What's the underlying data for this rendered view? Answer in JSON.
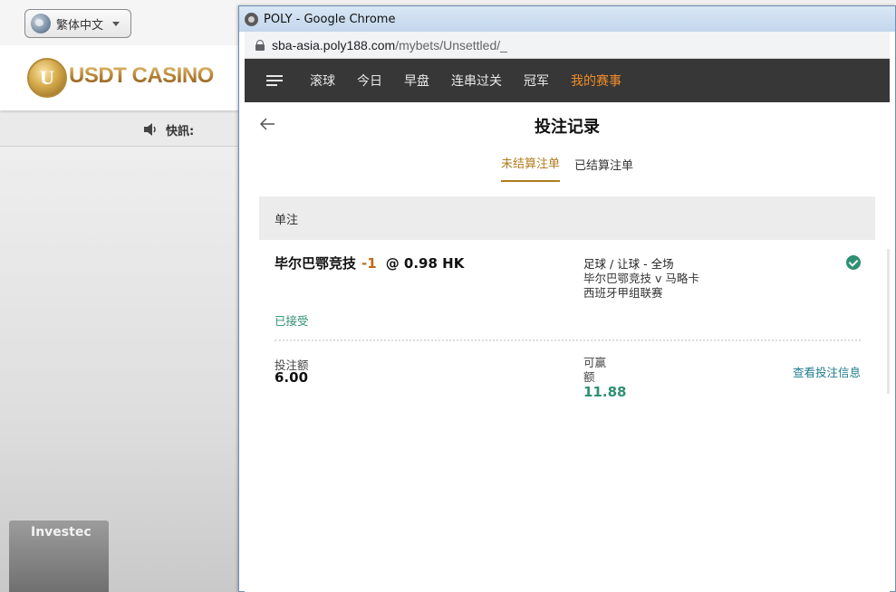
{
  "background_site": {
    "language_selector": "繁体中文",
    "logo_text": "USDT CASINO",
    "logo_letter": "U",
    "news_label": "快訊:",
    "ad_text": "Investec"
  },
  "browser": {
    "window_title": "POLY - Google Chrome",
    "url_host": "sba-asia.poly188.com",
    "url_path": "/mybets/Unsettled/_"
  },
  "site": {
    "nav": {
      "items": [
        {
          "label": "滚球"
        },
        {
          "label": "今日"
        },
        {
          "label": "早盘"
        },
        {
          "label": "连串过关"
        },
        {
          "label": "冠军"
        },
        {
          "label": "我的赛事"
        }
      ],
      "active_index": 5
    },
    "page_title": "投注记录",
    "tabs": [
      {
        "label": "未结算注单",
        "active": true
      },
      {
        "label": "已结算注单",
        "active": false
      }
    ],
    "section_title": "单注",
    "bet": {
      "team": "毕尔巴鄂竞技",
      "handicap": "-1",
      "at": "@",
      "odds": "0.98 HK",
      "market": "足球 / 让球 - 全场",
      "match": "毕尔巴鄂竞技 v 马略卡",
      "league": "西班牙甲组联赛",
      "status": "已接受",
      "stake_label": "投注额",
      "stake_value": "6.00",
      "win_label": "可赢额",
      "win_value": "11.88",
      "detail_link": "查看投注信息"
    }
  },
  "colors": {
    "nav_bg": "#373737",
    "nav_active": "#f08c2a",
    "tab_active": "#b07b1e",
    "accent_green": "#2e8f72",
    "link": "#1f7a8c"
  }
}
